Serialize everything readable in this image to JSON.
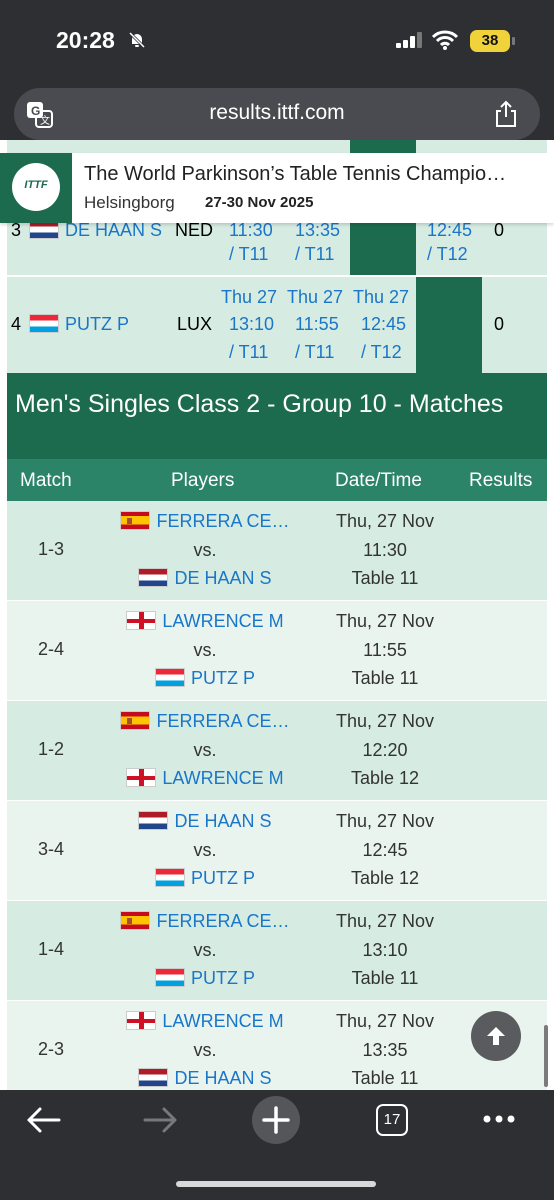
{
  "status_bar": {
    "time": "20:28",
    "battery": "38"
  },
  "browser": {
    "url": "results.ittf.com",
    "tab_count": "17"
  },
  "event": {
    "title": "The World Parkinson’s Table Tennis Champio…",
    "city": "Helsingborg",
    "dates": "27-30 Nov 2025",
    "logo_text": "ITTF"
  },
  "standings_partial": [
    {
      "rank": "3",
      "name": "DE HAAN S",
      "country": "NED",
      "cells": [
        {
          "time": "11:30",
          "table": "/ T11"
        },
        {
          "time": "13:35",
          "table": "/ T11"
        },
        {
          "time": "",
          "table": ""
        },
        {
          "time": "12:45",
          "table": "/ T12"
        }
      ],
      "points": "0"
    },
    {
      "rank": "4",
      "name": "PUTZ P",
      "country": "LUX",
      "cells": [
        {
          "day": "Thu 27",
          "time": "13:10",
          "table": "/ T11"
        },
        {
          "day": "Thu 27",
          "time": "11:55",
          "table": "/ T11"
        },
        {
          "day": "Thu 27",
          "time": "12:45",
          "table": "/ T12"
        }
      ],
      "points": "0"
    }
  ],
  "section_title": "Men's Singles Class 2 - Group 10 - Matches",
  "matches_header": {
    "match": "Match",
    "players": "Players",
    "datetime": "Date/Time",
    "results": "Results"
  },
  "matches": [
    {
      "code": "1-3",
      "p1": "FERRERA CE…",
      "vs": "vs.",
      "p2": "DE HAAN S",
      "date": "Thu, 27 Nov",
      "time": "11:30",
      "table": "Table 11"
    },
    {
      "code": "2-4",
      "p1": "LAWRENCE M",
      "vs": "vs.",
      "p2": "PUTZ P",
      "date": "Thu, 27 Nov",
      "time": "11:55",
      "table": "Table 11"
    },
    {
      "code": "1-2",
      "p1": "FERRERA CE…",
      "vs": "vs.",
      "p2": "LAWRENCE M",
      "date": "Thu, 27 Nov",
      "time": "12:20",
      "table": "Table 12"
    },
    {
      "code": "3-4",
      "p1": "DE HAAN S",
      "vs": "vs.",
      "p2": "PUTZ P",
      "date": "Thu, 27 Nov",
      "time": "12:45",
      "table": "Table 12"
    },
    {
      "code": "1-4",
      "p1": "FERRERA CE…",
      "vs": "vs.",
      "p2": "PUTZ P",
      "date": "Thu, 27 Nov",
      "time": "13:10",
      "table": "Table 11"
    },
    {
      "code": "2-3",
      "p1": "LAWRENCE M",
      "vs": "vs.",
      "p2": "DE HAAN S",
      "date": "Thu, 27 Nov",
      "time": "13:35",
      "table": "Table 11"
    }
  ],
  "colors": {
    "brand_green": "#1c6b4f",
    "header_green": "#2c8468",
    "row_light": "#d6ece2",
    "link_blue": "#1a76c8"
  },
  "icons": [
    "bell-off-icon",
    "signal-icon",
    "wifi-icon",
    "translate-icon",
    "share-icon",
    "scroll-up-icon",
    "back-icon",
    "forward-icon",
    "plus-icon",
    "tabs-icon",
    "more-icon"
  ]
}
